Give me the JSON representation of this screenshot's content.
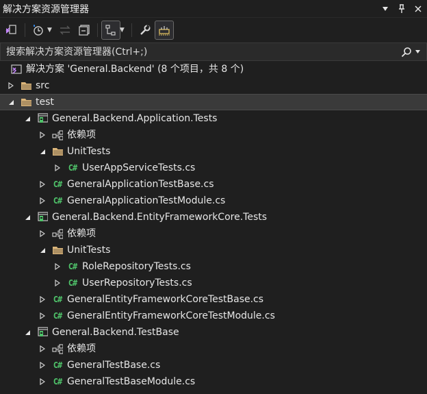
{
  "title": "解决方案资源管理器",
  "search": {
    "placeholder": "搜索解决方案资源管理器(Ctrl+;)"
  },
  "tree": {
    "solution": "解决方案 'General.Backend' (8 个项目，共 8 个)",
    "src": "src",
    "test": "test",
    "p1": "General.Backend.Application.Tests",
    "p1_deps": "依赖项",
    "p1_unit": "UnitTests",
    "p1_unit_f1": "UserAppServiceTests.cs",
    "p1_f1": "GeneralApplicationTestBase.cs",
    "p1_f2": "GeneralApplicationTestModule.cs",
    "p2": "General.Backend.EntityFrameworkCore.Tests",
    "p2_deps": "依赖项",
    "p2_unit": "UnitTests",
    "p2_unit_f1": "RoleRepositoryTests.cs",
    "p2_unit_f2": "UserRepositoryTests.cs",
    "p2_f1": "GeneralEntityFrameworkCoreTestBase.cs",
    "p2_f2": "GeneralEntityFrameworkCoreTestModule.cs",
    "p3": "General.Backend.TestBase",
    "p3_deps": "依赖项",
    "p3_f1": "GeneralTestBase.cs",
    "p3_f2": "GeneralTestBaseModule.cs"
  },
  "colors": {
    "background": "#1f1f1f",
    "folder": "#dcb67a",
    "csharp": "#4fc36a",
    "accent": "#c586ff"
  },
  "icons": {
    "cs_glyph": "C#"
  }
}
